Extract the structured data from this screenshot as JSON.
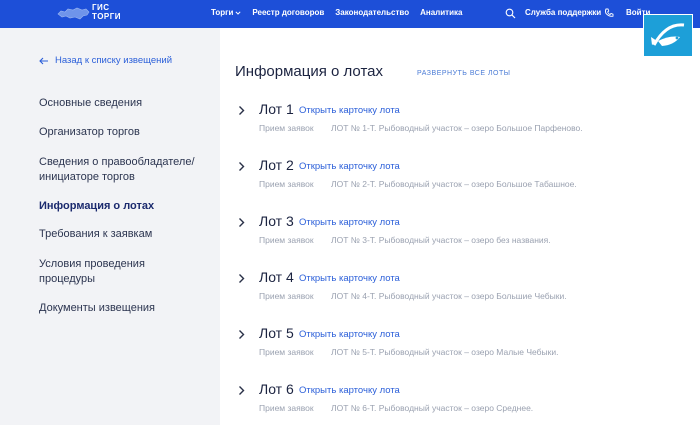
{
  "header": {
    "logo_line1": "ГИС",
    "logo_line2": "ТОРГИ",
    "nav": [
      {
        "label": "Торги",
        "has_dropdown": true
      },
      {
        "label": "Реестр договоров"
      },
      {
        "label": "Законодательство"
      },
      {
        "label": "Аналитика"
      }
    ],
    "support_label": "Служба поддержки",
    "login_label": "Войти",
    "bg_color": "#1d4fd8"
  },
  "sidebar": {
    "back_label": "Назад к списку извещений",
    "items": [
      {
        "label": "Основные сведения",
        "active": false
      },
      {
        "label": "Организатор торгов",
        "active": false
      },
      {
        "label": "Сведения о правообладателе/ инициаторе торгов",
        "active": false
      },
      {
        "label": "Информация о лотах",
        "active": true
      },
      {
        "label": "Требования к заявкам",
        "active": false
      },
      {
        "label": "Условия проведения процедуры",
        "active": false
      },
      {
        "label": "Документы извещения",
        "active": false
      }
    ]
  },
  "main": {
    "title": "Информация о лотах",
    "expand_all": "РАЗВЕРНУТЬ ВСЕ ЛОТЫ",
    "lots": [
      {
        "name": "Лот 1",
        "open_label": "Открыть карточку лота",
        "status": "Прием заявок",
        "desc": "ЛОТ № 1-Т. Рыбоводный участок – озеро Большое Парфеново."
      },
      {
        "name": "Лот 2",
        "open_label": "Открыть карточку лота",
        "status": "Прием заявок",
        "desc": "ЛОТ № 2-Т. Рыбоводный участок – озеро Большое Табашное."
      },
      {
        "name": "Лот 3",
        "open_label": "Открыть карточку лота",
        "status": "Прием заявок",
        "desc": "ЛОТ № 3-Т. Рыбоводный участок – озеро без названия."
      },
      {
        "name": "Лот 4",
        "open_label": "Открыть карточку лота",
        "status": "Прием заявок",
        "desc": "ЛОТ № 4-Т. Рыбоводный участок – озеро Большие Чебыки."
      },
      {
        "name": "Лот 5",
        "open_label": "Открыть карточку лота",
        "status": "Прием заявок",
        "desc": "ЛОТ № 5-Т. Рыбоводный участок – озеро Малые Чебыки."
      },
      {
        "name": "Лот 6",
        "open_label": "Открыть карточку лота",
        "status": "Прием заявок",
        "desc": "ЛОТ № 6-Т. Рыбоводный участок – озеро Среднее."
      }
    ]
  }
}
